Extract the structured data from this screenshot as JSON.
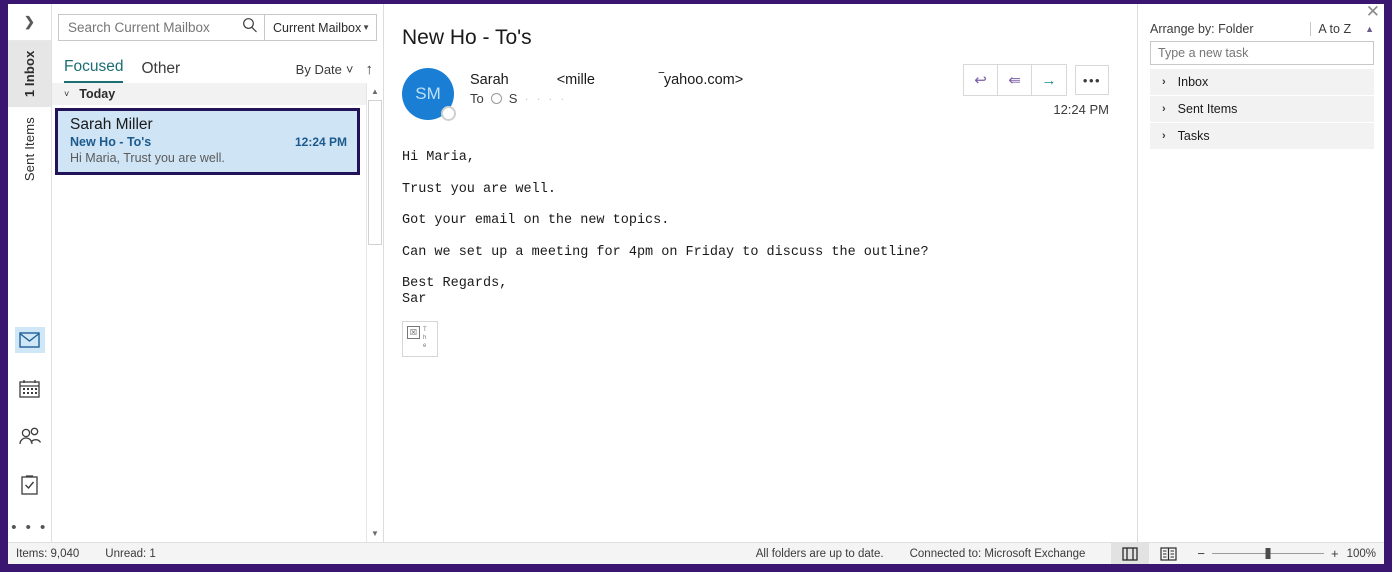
{
  "rail": {
    "expand_icon": "chevron-right-icon",
    "folder_tabs": [
      {
        "label": "Inbox",
        "count": "1",
        "selected": true
      },
      {
        "label": "Sent Items",
        "count": "",
        "selected": false
      }
    ],
    "modules": [
      {
        "name": "mail-icon",
        "active": true
      },
      {
        "name": "calendar-icon",
        "active": false
      },
      {
        "name": "people-icon",
        "active": false
      },
      {
        "name": "tasks-icon",
        "active": false
      }
    ],
    "overflow": "• • •"
  },
  "search": {
    "placeholder": "Search Current Mailbox",
    "icon": "search-icon",
    "scope": "Current Mailbox",
    "scope_caret": "▼"
  },
  "list": {
    "tabs": [
      {
        "label": "Focused",
        "selected": true
      },
      {
        "label": "Other",
        "selected": false
      }
    ],
    "sort_by": "By Date",
    "sort_caret": "⌄",
    "sort_direction_icon": "↑",
    "group_header": "Today",
    "group_chevron": "⌄",
    "messages": [
      {
        "from": "Sarah Miller",
        "subject": "New Ho - To's",
        "time": "12:24 PM",
        "preview": "Hi Maria,  Trust you are well.",
        "selected": true
      }
    ],
    "scroll_up": "▲",
    "scroll_down": "▼"
  },
  "reading": {
    "subject": "New Ho - To's",
    "avatar_initials": "SM",
    "from_name": "Sarah",
    "from_addr_start": "<mille",
    "from_addr_end": "‾yahoo.com>",
    "to_label": "To",
    "to_recipient": "S",
    "to_redacted": "·  ·   · ·",
    "timestamp": "12:24 PM",
    "actions": [
      {
        "name": "reply-button",
        "glyph": "↩",
        "tone": "purple"
      },
      {
        "name": "reply-all-button",
        "glyph": "⇚",
        "tone": "purple"
      },
      {
        "name": "forward-button",
        "glyph": "→",
        "tone": "teal"
      }
    ],
    "more_actions": "•••",
    "body": [
      "Hi Maria,",
      "Trust you are well.",
      "Got your email on the new topics.",
      "Can we set up a meeting for 4pm on Friday to discuss the outline?"
    ],
    "signoff_1": "Best Regards,",
    "signoff_2": "Sar",
    "broken_image": {
      "glyph": "☒",
      "alt": "The"
    }
  },
  "tasks": {
    "close_icon": "✕",
    "arrange_by": "Arrange by: Folder",
    "sort_order": "A to Z",
    "collapse_icon": "▲",
    "new_task_placeholder": "Type a new task",
    "groups": [
      {
        "label": "Inbox",
        "chevron": "›"
      },
      {
        "label": "Sent Items",
        "chevron": "›"
      },
      {
        "label": "Tasks",
        "chevron": "›"
      }
    ]
  },
  "status": {
    "items_count": "Items: 9,040",
    "unread_count": "Unread: 1",
    "sync_state": "All folders are up to date.",
    "connection": "Connected to: Microsoft Exchange",
    "normal_view_icon": "normal-view-icon",
    "reading_view_icon": "reading-view-icon",
    "zoom_out": "−",
    "zoom_in": "+",
    "zoom_level": "100%"
  }
}
